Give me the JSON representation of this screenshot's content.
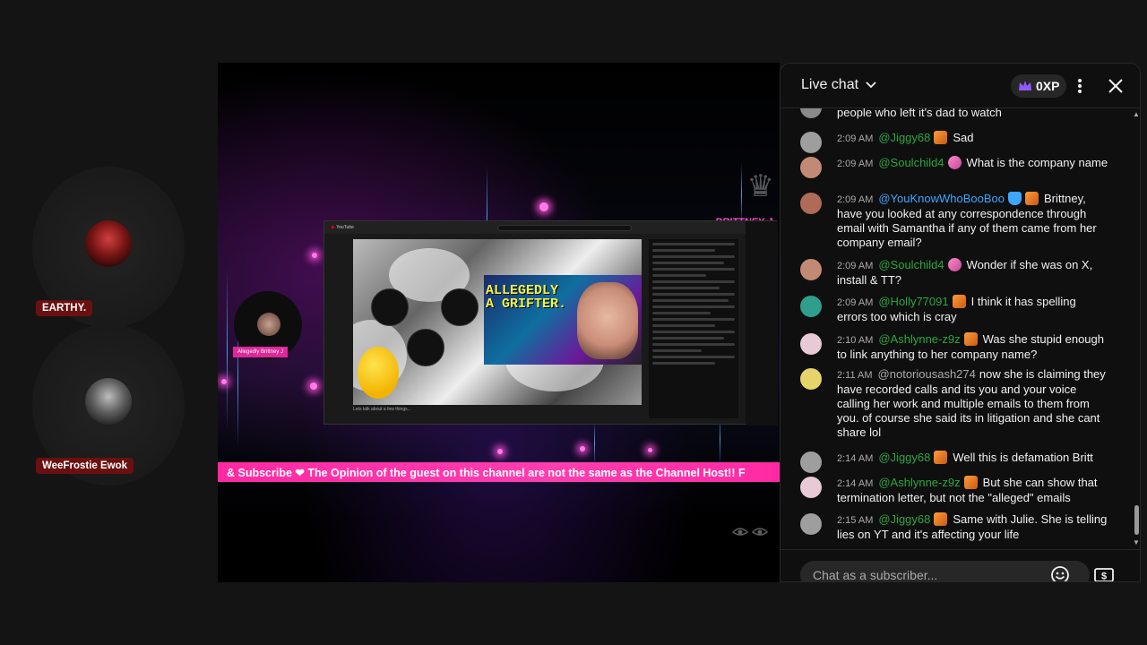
{
  "participants": [
    {
      "name": "EARTHY."
    },
    {
      "name": "WeeFrostie Ewok"
    }
  ],
  "video": {
    "ticker_text": "& Subscribe ❤ The Opinion of the guest on this channel are not the same as the Channel Host!! F",
    "inner_overlay_text": "ALLEGEDLY\nA GRIFTER.",
    "host_tag": "Allegedly Brittney J",
    "brand_text": "BRITTNEY J",
    "inner_caption": "Lets talk about a few things...",
    "inner_app": "YouTube"
  },
  "chat": {
    "title": "Live chat",
    "xp": "0XP",
    "input_placeholder": "Chat as a subscriber...",
    "messages": [
      {
        "time": "",
        "author": "",
        "text": "people who left it's dad to watch",
        "avatar_color": "#8a8a8a",
        "badge": "",
        "author_style": ""
      },
      {
        "time": "2:09 AM",
        "author": "@Jiggy68",
        "text": "Sad",
        "avatar_color": "#9e9e9e",
        "badge": "orange",
        "author_style": ""
      },
      {
        "time": "2:09 AM",
        "author": "@Soulchild4",
        "text": "What is the company name",
        "avatar_color": "#c28a74",
        "badge": "pink",
        "author_style": ""
      },
      {
        "time": "2:09 AM",
        "author": "@YouKnowWhoBooBoo",
        "text": "Brittney, have you looked at any correspondence through email with Samantha if any of them came from her company email?",
        "avatar_color": "#b06a58",
        "badge": "orange",
        "author_style": "mod"
      },
      {
        "time": "2:09 AM",
        "author": "@Soulchild4",
        "text": "Wonder if she was on X, install & TT?",
        "avatar_color": "#c28a74",
        "badge": "pink",
        "author_style": ""
      },
      {
        "time": "2:09 AM",
        "author": "@Holly77091",
        "text": "I think it has spelling errors too which is cray",
        "avatar_color": "#2f9e8c",
        "badge": "orange",
        "author_style": ""
      },
      {
        "time": "2:10 AM",
        "author": "@Ashlynne-z9z",
        "text": "Was she stupid enough to link anything to her company name?",
        "avatar_color": "#e8c9d6",
        "badge": "orange",
        "author_style": ""
      },
      {
        "time": "2:11 AM",
        "author": "@notoriousash274",
        "text": "now she is claiming they have recorded calls and its you and your voice calling her work and multiple emails to them from you. of course she said its in litigation and she cant share lol",
        "avatar_color": "#e6d36a",
        "badge": "",
        "author_style": "plain"
      },
      {
        "time": "2:14 AM",
        "author": "@Jiggy68",
        "text": "Well this is defamation Britt",
        "avatar_color": "#9e9e9e",
        "badge": "orange",
        "author_style": ""
      },
      {
        "time": "2:14 AM",
        "author": "@Ashlynne-z9z",
        "text": "But she can show that termination letter, but not the \"alleged\" emails",
        "avatar_color": "#e8c9d6",
        "badge": "orange",
        "author_style": ""
      },
      {
        "time": "2:15 AM",
        "author": "@Jiggy68",
        "text": "Same with Julie. She is telling lies on YT and it's affecting your life",
        "avatar_color": "#9e9e9e",
        "badge": "orange",
        "author_style": ""
      }
    ]
  }
}
